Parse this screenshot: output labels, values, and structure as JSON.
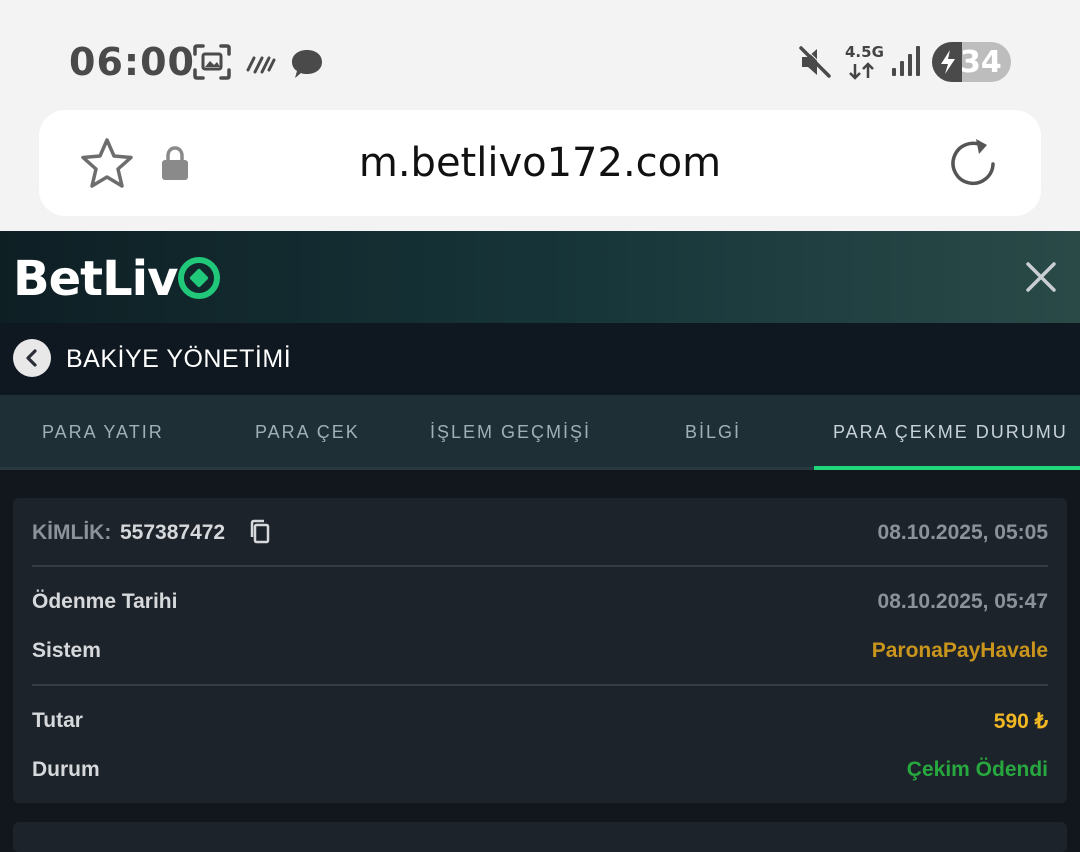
{
  "status_bar": {
    "time": "06:00",
    "network_type": "4.5G",
    "battery_level": "34",
    "icons": [
      "screenshot-icon",
      "rain-icon",
      "message-icon",
      "mute-icon",
      "network-arrows-icon",
      "signal-icon",
      "battery-charging-icon"
    ]
  },
  "browser": {
    "url": "m.betlivo172.com",
    "icons": [
      "star-icon",
      "lock-icon",
      "reload-icon"
    ]
  },
  "app": {
    "logo_text": "BetLiv",
    "brand_color": "#21c87a"
  },
  "page": {
    "title": "BAKİYE YÖNETİMİ"
  },
  "tabs": [
    {
      "label": "PARA YATIR"
    },
    {
      "label": "PARA ÇEK"
    },
    {
      "label": "İŞLEM GEÇMİŞİ"
    },
    {
      "label": "BİLGİ"
    },
    {
      "label": "PARA ÇEKME DURUMU",
      "active": true
    }
  ],
  "withdrawal": {
    "id_label": "KİMLİK:",
    "id_value": "557387472",
    "created_at": "08.10.2025, 05:05",
    "payment_date_label": "Ödenme Tarihi",
    "payment_date": "08.10.2025, 05:47",
    "system_label": "Sistem",
    "system_value": "ParonaPayHavale",
    "amount_label": "Tutar",
    "amount_value": "590 ₺",
    "status_label": "Durum",
    "status_value": "Çekim Ödendi",
    "colors": {
      "system": "#c9951c",
      "amount": "#f2b824",
      "status": "#27a83f"
    }
  }
}
